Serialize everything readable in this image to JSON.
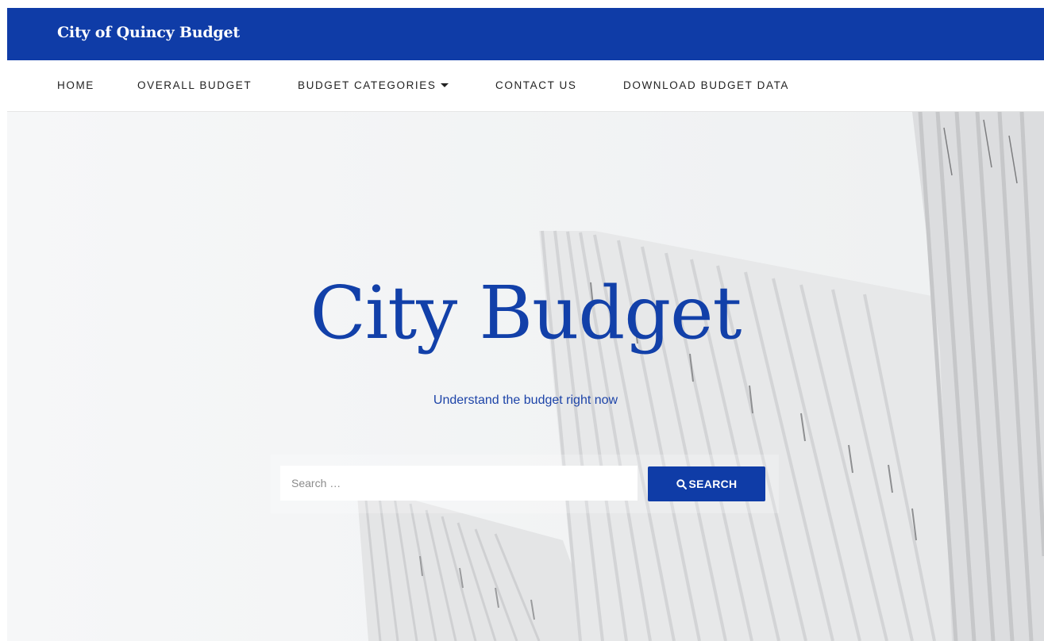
{
  "header": {
    "site_title": "City of Quincy Budget",
    "brand_color": "#0f3ca7"
  },
  "nav": {
    "items": [
      {
        "label": "HOME",
        "has_dropdown": false
      },
      {
        "label": "OVERALL BUDGET",
        "has_dropdown": false
      },
      {
        "label": "BUDGET CATEGORIES",
        "has_dropdown": true
      },
      {
        "label": "CONTACT US",
        "has_dropdown": false
      },
      {
        "label": "DOWNLOAD BUDGET DATA",
        "has_dropdown": false
      }
    ]
  },
  "hero": {
    "title": "City Budget",
    "subtitle": "Understand the budget right now",
    "title_color": "#1240a9"
  },
  "search": {
    "placeholder": "Search …",
    "value": "",
    "button_label": "SEARCH",
    "button_icon": "search-icon"
  }
}
